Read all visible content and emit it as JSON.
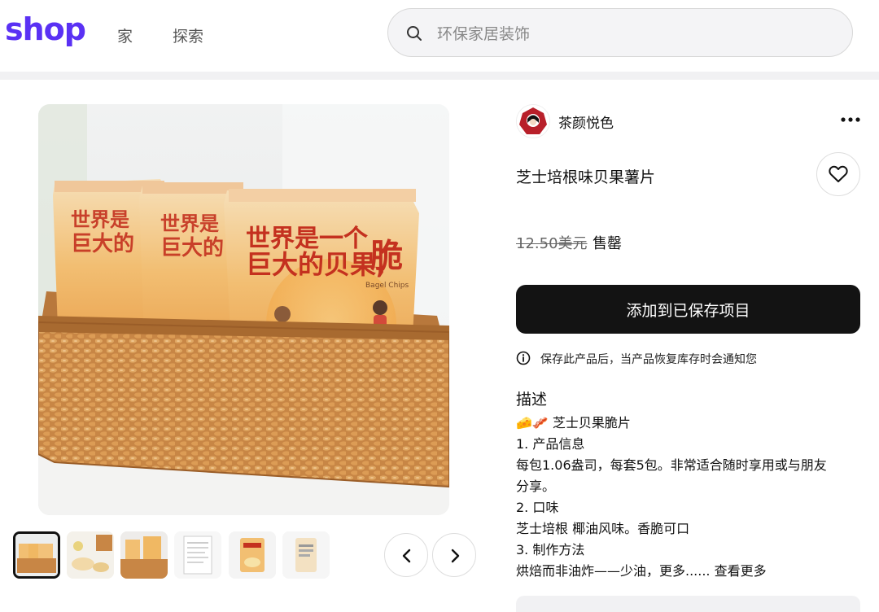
{
  "header": {
    "logo": "shop",
    "nav": [
      "家",
      "探索"
    ],
    "search": {
      "placeholder": "环保家居装饰",
      "value": ""
    }
  },
  "product": {
    "shop_name": "茶颜悦色",
    "title": "芝士培根味贝果薯片",
    "price": "12.50美元",
    "status": "售罄",
    "save_button": "添加到已保存项目",
    "notice": "保存此产品后，当产品恢复库存时会通知您",
    "description_title": "描述",
    "description_lines": [
      "🧀🥓 芝士贝果脆片",
      "1. 产品信息",
      "每包1.06盎司，每套5包。非常适合随时享用或与朋友",
      "分享。",
      "2. 口味",
      "芝士培根 椰油风味。香脆可口",
      "3. 制作方法",
      "烘焙而非油炸——少油，更多...... 查看更多"
    ],
    "bag_text": {
      "line1": "世界是一个",
      "line2": "巨大的贝果,",
      "crisp": "脆",
      "brand": "Bagel Chips"
    },
    "thumbnail_count": 6
  },
  "icons": {
    "search": "search-icon",
    "more": "more-dots-icon",
    "favorite": "heart-icon",
    "info": "info-icon",
    "prev": "chevron-left-icon",
    "next": "chevron-right-icon"
  },
  "colors": {
    "brand": "#5a31f4",
    "button": "#131313"
  }
}
